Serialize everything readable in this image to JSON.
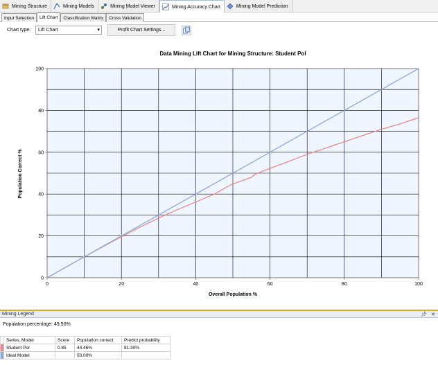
{
  "top_tabs": [
    {
      "label": "Mining Structure",
      "icon": "mining-structure-icon",
      "active": false
    },
    {
      "label": "Mining Models",
      "icon": "mining-models-icon",
      "active": false
    },
    {
      "label": "Mining Model Viewer",
      "icon": "model-viewer-icon",
      "active": false
    },
    {
      "label": "Mining Accuracy Chart",
      "icon": "accuracy-chart-icon",
      "active": true
    },
    {
      "label": "Mining Model Prediction",
      "icon": "model-prediction-icon",
      "active": false
    }
  ],
  "sub_tabs": [
    {
      "label": "Input Selection",
      "active": false
    },
    {
      "label": "Lift Chart",
      "active": true
    },
    {
      "label": "Classification Matrix",
      "active": false
    },
    {
      "label": "Cross Validation",
      "active": false
    }
  ],
  "toolbar": {
    "chart_type_label": "Chart type:",
    "chart_type_value": "Lift Chart",
    "profit_button": "Profit Chart Settings..."
  },
  "chart_data": {
    "type": "line",
    "title": "Data Mining Lift Chart for Mining Structure: Student Pol",
    "xlabel": "Overall Population %",
    "ylabel": "Population Correct %",
    "xlim": [
      0,
      100
    ],
    "ylim": [
      0,
      100
    ],
    "x_ticks": [
      0,
      20,
      40,
      60,
      80,
      100
    ],
    "y_ticks": [
      0,
      20,
      40,
      60,
      80,
      100
    ],
    "grid": true,
    "series": [
      {
        "name": "Student Pol",
        "color": "#e8868e",
        "x": [
          0,
          5,
          10,
          15,
          20,
          25,
          30,
          35,
          40,
          45,
          49.5,
          55,
          56,
          60,
          65,
          70,
          75,
          80,
          85,
          90,
          95,
          100
        ],
        "y": [
          0,
          5,
          10,
          14.8,
          19.6,
          24.2,
          28.5,
          32.5,
          36.2,
          40,
          44.46,
          48,
          49.5,
          52.3,
          55.6,
          59,
          62,
          65,
          68,
          71,
          73.5,
          76.5
        ]
      },
      {
        "name": "Ideal Model",
        "color": "#8caadc",
        "x": [
          0,
          100
        ],
        "y": [
          0,
          100
        ]
      }
    ]
  },
  "legend": {
    "title": "Mining Legend",
    "population_percentage": "Population percentage: 49.50%",
    "columns": [
      "Series, Model",
      "Score",
      "Population correct",
      "Predict probability"
    ],
    "rows": [
      {
        "name": "Student Pol",
        "score": "0.85",
        "population_correct": "44.46%",
        "predict_probability": "81.30%",
        "color": "#e8868e"
      },
      {
        "name": "Ideal Model",
        "score": "",
        "population_correct": "50.00%",
        "predict_probability": "",
        "color": "#8caadc"
      }
    ]
  },
  "colors": {
    "plot_background": "#f0f6ff",
    "accent": "#e6a23c"
  }
}
